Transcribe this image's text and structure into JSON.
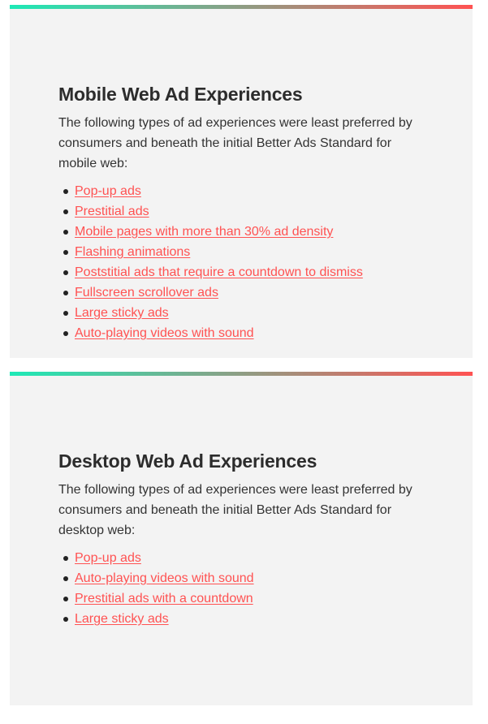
{
  "colors": {
    "gradient_start": "#1de9b6",
    "gradient_end": "#ff5252",
    "panel_background": "#f3f3f3",
    "link": "#ff5252",
    "text": "#333333"
  },
  "sections": [
    {
      "title": "Mobile Web Ad Experiences",
      "description": "The following types of ad experiences were least preferred by consumers and beneath the initial Better Ads Standard for mobile web:",
      "items": [
        "Pop-up ads",
        "Prestitial ads",
        "Mobile pages with more than 30% ad density",
        "Flashing animations",
        "Poststitial ads that require a countdown to dismiss",
        "Fullscreen scrollover ads",
        "Large sticky ads",
        "Auto-playing videos with sound"
      ]
    },
    {
      "title": "Desktop Web Ad Experiences",
      "description": "The following types of ad experiences were least preferred by consumers and beneath the initial Better Ads Standard for desktop web:",
      "items": [
        "Pop-up ads",
        "Auto-playing videos with sound",
        "Prestitial ads with a countdown",
        "Large sticky ads"
      ]
    }
  ]
}
